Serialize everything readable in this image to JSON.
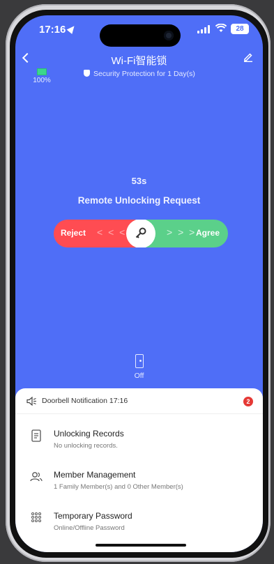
{
  "status_bar": {
    "time": "17:16",
    "battery": "28"
  },
  "nav": {
    "title": "Wi-Fi智能锁"
  },
  "device": {
    "battery_percent": "100%",
    "security_text": "Security Protection for 1 Day(s)"
  },
  "request": {
    "countdown": "53s",
    "title": "Remote Unlocking Request",
    "reject_label": "Reject",
    "agree_label": "Agree",
    "left_arrows": "< < < <",
    "right_arrows": "> > >"
  },
  "lock_state": {
    "label": "Off"
  },
  "notification": {
    "text": "Doorbell Notification 17:16",
    "badge": "2"
  },
  "menu": [
    {
      "title": "Unlocking Records",
      "subtitle": "No unlocking records.",
      "icon": "document-icon"
    },
    {
      "title": "Member Management",
      "subtitle": "1 Family Member(s) and 0 Other Member(s)",
      "icon": "members-icon"
    },
    {
      "title": "Temporary Password",
      "subtitle": "Online/Offline Password",
      "icon": "keypad-icon"
    }
  ],
  "colors": {
    "background": "#4f6ef7",
    "reject": "#ff4c52",
    "agree": "#5bd08a",
    "badge": "#e53935"
  }
}
